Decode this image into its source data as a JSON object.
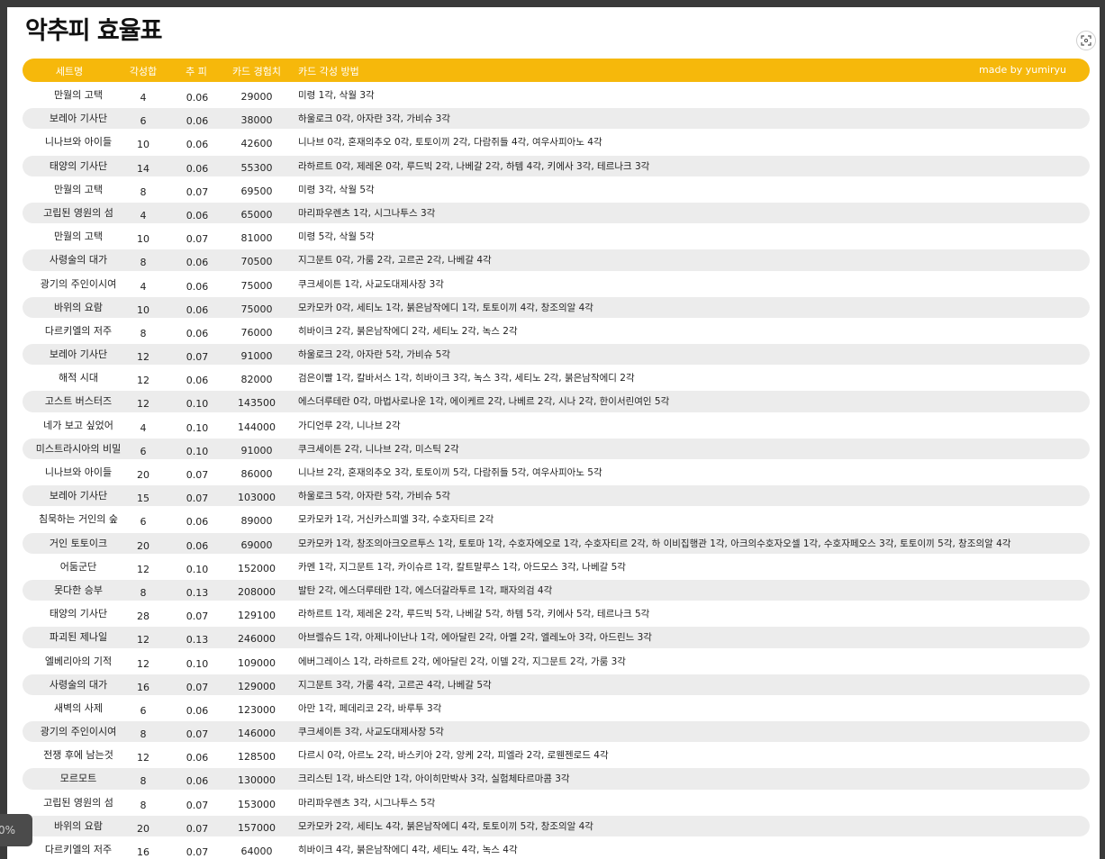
{
  "page": {
    "title": "악추피 효율표"
  },
  "header": {
    "set_name": "세트명",
    "level": "각성합",
    "efficiency": "추 피",
    "exp": "카드 경험치",
    "method": "카드 각성 방법",
    "credit": "made by yumiryu"
  },
  "colors": {
    "header_bg": "#f6b80b",
    "row_alt": "#ececec"
  },
  "zoom": {
    "label": "0%"
  },
  "rows": [
    {
      "name": "만월의 고택",
      "level": "4",
      "eff": "0.06",
      "exp": "29000",
      "method": "미령 1각, 삭월 3각"
    },
    {
      "name": "보레아 기사단",
      "level": "6",
      "eff": "0.06",
      "exp": "38000",
      "method": "하울로크 0각, 아자란 3각, 가비슈 3각"
    },
    {
      "name": "니나브와 아이들",
      "level": "10",
      "eff": "0.06",
      "exp": "42600",
      "method": "니나브 0각, 혼재의추오 0각, 토토이끼 2각, 다람쥐들 4각, 여우사피아노 4각"
    },
    {
      "name": "태양의 기사단",
      "level": "14",
      "eff": "0.06",
      "exp": "55300",
      "method": "라하르트 0각, 제레온 0각, 루드빅 2각, 나베갈 2각, 하템 4각, 키에사 3각, 테르나크 3각"
    },
    {
      "name": "만월의 고택",
      "level": "8",
      "eff": "0.07",
      "exp": "69500",
      "method": "미령 3각, 삭월 5각"
    },
    {
      "name": "고립된 영원의 섬",
      "level": "4",
      "eff": "0.06",
      "exp": "65000",
      "method": "마리파우렌츠 1각, 시그나투스 3각"
    },
    {
      "name": "만월의 고택",
      "level": "10",
      "eff": "0.07",
      "exp": "81000",
      "method": "미령 5각, 삭월 5각"
    },
    {
      "name": "사령술의 대가",
      "level": "8",
      "eff": "0.06",
      "exp": "70500",
      "method": "지그문트 0각, 가룸 2각, 고르곤 2각, 나베갈 4각"
    },
    {
      "name": "광기의 주인이시여",
      "level": "4",
      "eff": "0.06",
      "exp": "75000",
      "method": "쿠크세이튼 1각, 사교도대제사장 3각"
    },
    {
      "name": "바위의 요람",
      "level": "10",
      "eff": "0.06",
      "exp": "75000",
      "method": "모카모카 0각, 세티노 1각, 붉은남작에디 1각, 토토이끼 4각, 창조의알 4각"
    },
    {
      "name": "다르키엘의 저주",
      "level": "8",
      "eff": "0.06",
      "exp": "76000",
      "method": "히바이크 2각, 붉은남작에디 2각, 세티노 2각, 녹스 2각"
    },
    {
      "name": "보레아 기사단",
      "level": "12",
      "eff": "0.07",
      "exp": "91000",
      "method": "하울로크 2각, 아자란 5각, 가비슈 5각"
    },
    {
      "name": "해적 시대",
      "level": "12",
      "eff": "0.06",
      "exp": "82000",
      "method": "검은이빨 1각, 칼바서스 1각, 히바이크 3각, 녹스 3각, 세티노 2각, 붉은남작에디 2각"
    },
    {
      "name": "고스트 버스터즈",
      "level": "12",
      "eff": "0.10",
      "exp": "143500",
      "method": "에스더루테란 0각, 마법사로나운 1각, 에이케르 2각, 나베르 2각, 시나 2각, 한이서린여인 5각"
    },
    {
      "name": "네가 보고 싶었어",
      "level": "4",
      "eff": "0.10",
      "exp": "144000",
      "method": "가디언루 2각, 니나브 2각"
    },
    {
      "name": "미스트라시아의 비밀",
      "level": "6",
      "eff": "0.10",
      "exp": "91000",
      "method": "쿠크세이튼 2각, 니나브 2각, 미스틱 2각"
    },
    {
      "name": "니나브와 아이들",
      "level": "20",
      "eff": "0.07",
      "exp": "86000",
      "method": "니나브 2각, 혼재의추오 3각, 토토이끼 5각, 다람쥐들 5각, 여우사피아노 5각"
    },
    {
      "name": "보레아 기사단",
      "level": "15",
      "eff": "0.07",
      "exp": "103000",
      "method": "하울로크 5각, 아자란 5각, 가비슈 5각"
    },
    {
      "name": "침묵하는 거인의 숲",
      "level": "6",
      "eff": "0.06",
      "exp": "89000",
      "method": "모카모카 1각, 거신카스피엘 3각, 수호자티르 2각"
    },
    {
      "name": "거인 토토이크",
      "level": "20",
      "eff": "0.06",
      "exp": "69000",
      "method": "모카모카 1각, 창조의아크오르투스 1각, 토토마 1각, 수호자에오로 1각, 수호자티르 2각, 하 이비집행관 1각, 아크의수호자오셀 1각, 수호자페오스 3각, 토토이끼 5각, 창조의알 4각"
    },
    {
      "name": "어둠군단",
      "level": "12",
      "eff": "0.10",
      "exp": "152000",
      "method": "카멘 1각, 지그문트 1각, 카이슈르 1각, 칼트말루스 1각, 아드모스 3각, 나베갈 5각"
    },
    {
      "name": "못다한 승부",
      "level": "8",
      "eff": "0.13",
      "exp": "208000",
      "method": "발탄 2각, 에스더루테란 1각, 에스더갈라투르 1각, 패자의검 4각"
    },
    {
      "name": "태양의 기사단",
      "level": "28",
      "eff": "0.07",
      "exp": "129100",
      "method": "라하르트 1각, 제레온 2각, 루드빅 5각, 나베갈 5각, 하템 5각, 키에사 5각, 테르나크 5각"
    },
    {
      "name": "파괴된 제나일",
      "level": "12",
      "eff": "0.13",
      "exp": "246000",
      "method": "아브렐슈드 1각, 아제나이난나 1각, 에아달린 2각, 아멜 2각, 엘레노아 3각, 아드린느 3각"
    },
    {
      "name": "엘베리아의 기적",
      "level": "12",
      "eff": "0.10",
      "exp": "109000",
      "method": "에버그레이스 1각, 라하르트 2각, 에아달린 2각, 이델 2각, 지그문트 2각, 가룸 3각"
    },
    {
      "name": "사령술의 대가",
      "level": "16",
      "eff": "0.07",
      "exp": "129000",
      "method": "지그문트 3각, 가룸 4각, 고르곤 4각, 나베갈 5각"
    },
    {
      "name": "새벽의 사제",
      "level": "6",
      "eff": "0.06",
      "exp": "123000",
      "method": "아만 1각, 페데리코 2각, 바루투 3각"
    },
    {
      "name": "광기의 주인이시여",
      "level": "8",
      "eff": "0.07",
      "exp": "146000",
      "method": "쿠크세이튼 3각, 사교도대제사장 5각"
    },
    {
      "name": "전쟁 후에 남는것",
      "level": "12",
      "eff": "0.06",
      "exp": "128500",
      "method": "다르시 0각, 아르노 2각, 바스키아 2각, 앙케 2각, 피엘라 2각, 로웬젠로드 4각"
    },
    {
      "name": "모르모트",
      "level": "8",
      "eff": "0.06",
      "exp": "130000",
      "method": "크리스틴 1각, 바스티안 1각, 아이히만박사 3각, 실험체타르마콤 3각"
    },
    {
      "name": "고립된 영원의 섬",
      "level": "8",
      "eff": "0.07",
      "exp": "153000",
      "method": "마리파우렌츠 3각, 시그나투스 5각"
    },
    {
      "name": "바위의 요람",
      "level": "20",
      "eff": "0.07",
      "exp": "157000",
      "method": "모카모카 2각, 세티노 4각, 붉은남작에디 4각, 토토이끼 5각, 창조의알 4각"
    },
    {
      "name": "다르키엘의 저주",
      "level": "16",
      "eff": "0.07",
      "exp": "64000",
      "method": "히바이크 4각, 붉은남작에디 4각, 세티노 4각, 녹스 4각"
    }
  ]
}
